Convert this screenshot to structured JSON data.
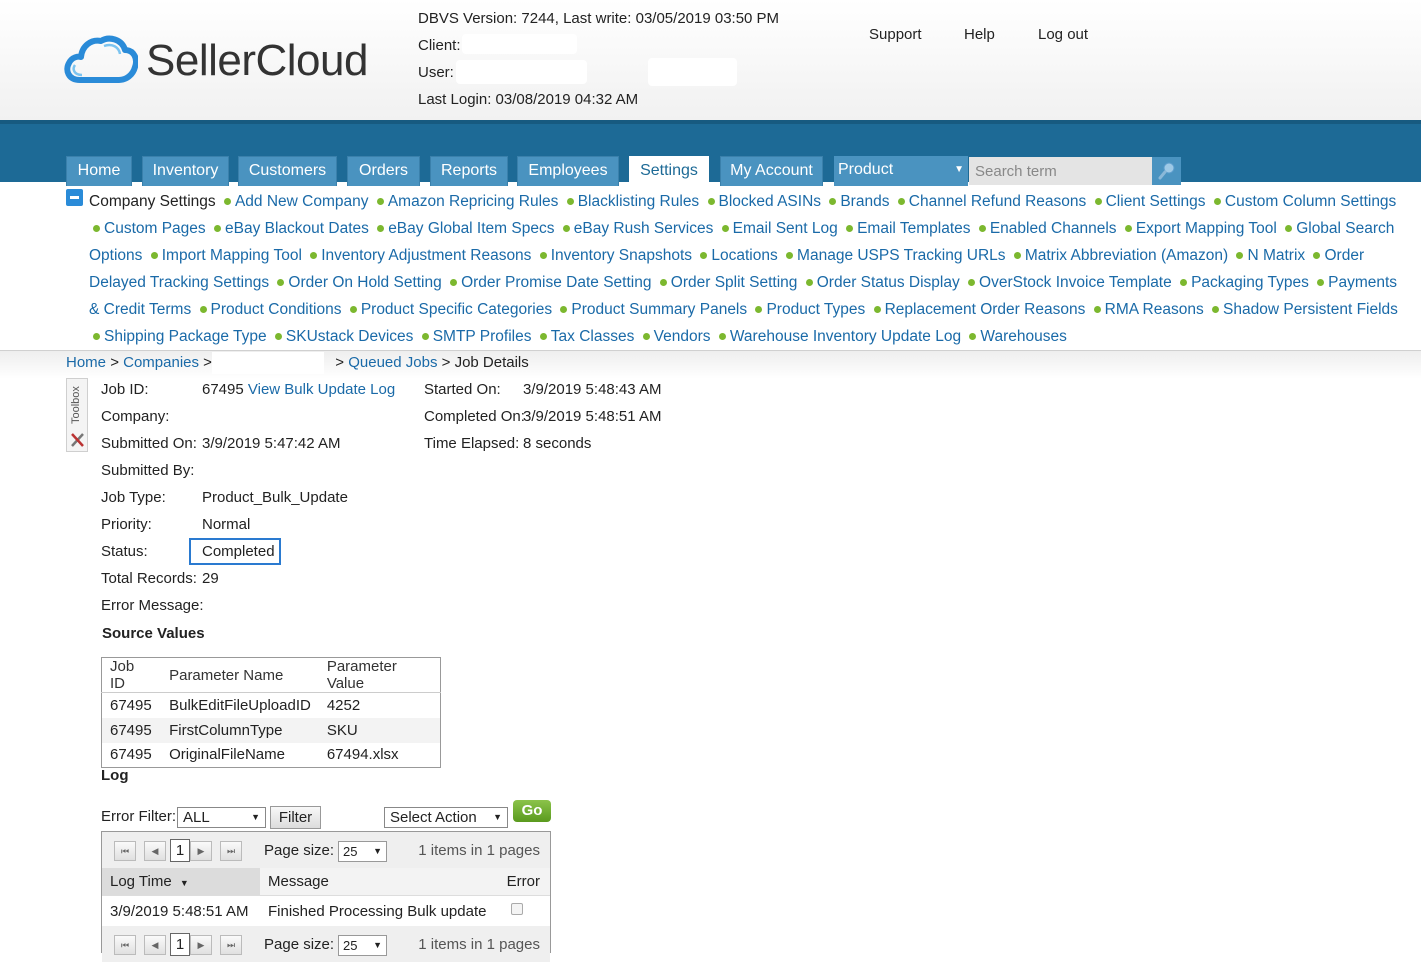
{
  "header": {
    "logo_text": "SellerCloud",
    "version_line": "DBVS Version: 7244, Last write: 03/05/2019 03:50 PM",
    "client_label": "Client:",
    "user_label": "User:",
    "last_login": "Last Login: 03/08/2019 04:32 AM",
    "links": {
      "support": "Support",
      "help": "Help",
      "logout": "Log out"
    }
  },
  "nav": {
    "tabs": [
      "Home",
      "Inventory",
      "Customers",
      "Orders",
      "Reports",
      "Employees",
      "Settings",
      "My Account"
    ],
    "active_tab": "Settings",
    "product_select": "Product",
    "search_placeholder": "Search term"
  },
  "settings_links": {
    "current": "Company Settings",
    "items": [
      "Add New Company",
      "Amazon Repricing Rules",
      "Blacklisting Rules",
      "Blocked ASINs",
      "Brands",
      "Channel Refund Reasons",
      "Client Settings",
      "Custom Column Settings",
      "Custom Pages",
      "eBay Blackout Dates",
      "eBay Global Item Specs",
      "eBay Rush Services",
      "Email Sent Log",
      "Email Templates",
      "Enabled Channels",
      "Export Mapping Tool",
      "Global Search Options",
      "Import Mapping Tool",
      "Inventory Adjustment Reasons",
      "Inventory Snapshots",
      "Locations",
      "Manage USPS Tracking URLs",
      "Matrix Abbreviation (Amazon)",
      "N Matrix",
      "Order Delayed Tracking Settings",
      "Order On Hold Setting",
      "Order Promise Date Setting",
      "Order Split Setting",
      "Order Status Display",
      "OverStock Invoice Template",
      "Packaging Types",
      "Payments & Credit Terms",
      "Product Conditions",
      "Product Specific Categories",
      "Product Summary Panels",
      "Product Types",
      "Replacement Order Reasons",
      "RMA Reasons",
      "Shadow Persistent Fields",
      "Shipping Package Type",
      "SKUstack Devices",
      "SMTP Profiles",
      "Tax Classes",
      "Vendors",
      "Warehouse Inventory Update Log",
      "Warehouses"
    ]
  },
  "breadcrumb": {
    "home": "Home",
    "companies": "Companies",
    "queued_jobs": "Queued Jobs",
    "current": "Job Details"
  },
  "toolbox_label": "Toolbox",
  "job": {
    "job_id_label": "Job ID:",
    "job_id": "67495",
    "view_log_link": "View Bulk Update Log",
    "company_label": "Company:",
    "submitted_on_label": "Submitted On:",
    "submitted_on": "3/9/2019 5:47:42 AM",
    "submitted_by_label": "Submitted By:",
    "job_type_label": "Job Type:",
    "job_type": "Product_Bulk_Update",
    "priority_label": "Priority:",
    "priority": "Normal",
    "status_label": "Status:",
    "status": "Completed",
    "total_records_label": "Total Records:",
    "total_records": "29",
    "error_message_label": "Error Message:",
    "started_on_label": "Started On:",
    "started_on": "3/9/2019 5:48:43 AM",
    "completed_on_label": "Completed On:",
    "completed_on": "3/9/2019 5:48:51 AM",
    "time_elapsed_label": "Time Elapsed:",
    "time_elapsed": "8 seconds"
  },
  "source_values": {
    "title": "Source Values",
    "headers": [
      "Job ID",
      "Parameter Name",
      "Parameter Value"
    ],
    "rows": [
      [
        "67495",
        "BulkEditFileUploadID",
        "4252"
      ],
      [
        "67495",
        "FirstColumnType",
        "SKU"
      ],
      [
        "67495",
        "OriginalFileName",
        "67494.xlsx"
      ]
    ]
  },
  "log": {
    "title": "Log",
    "error_filter_label": "Error Filter:",
    "error_filter_value": "ALL",
    "filter_button": "Filter",
    "action_select": "Select Action",
    "go_button": "Go",
    "pager": {
      "page": "1",
      "page_size_label": "Page size:",
      "page_size": "25",
      "info": "1 items in 1 pages"
    },
    "columns": [
      "Log Time",
      "Message",
      "Error"
    ],
    "rows": [
      {
        "time": "3/9/2019 5:48:51 AM",
        "message": "Finished Processing Bulk update",
        "error": false
      }
    ]
  },
  "colors": {
    "nav_bar": "#1d6a96",
    "nav_tab": "#4a93c0",
    "link": "#1a6aa8",
    "bullet": "#7cb82f",
    "go_button": "#6aab2a",
    "status_outline": "#2a7ad0"
  }
}
